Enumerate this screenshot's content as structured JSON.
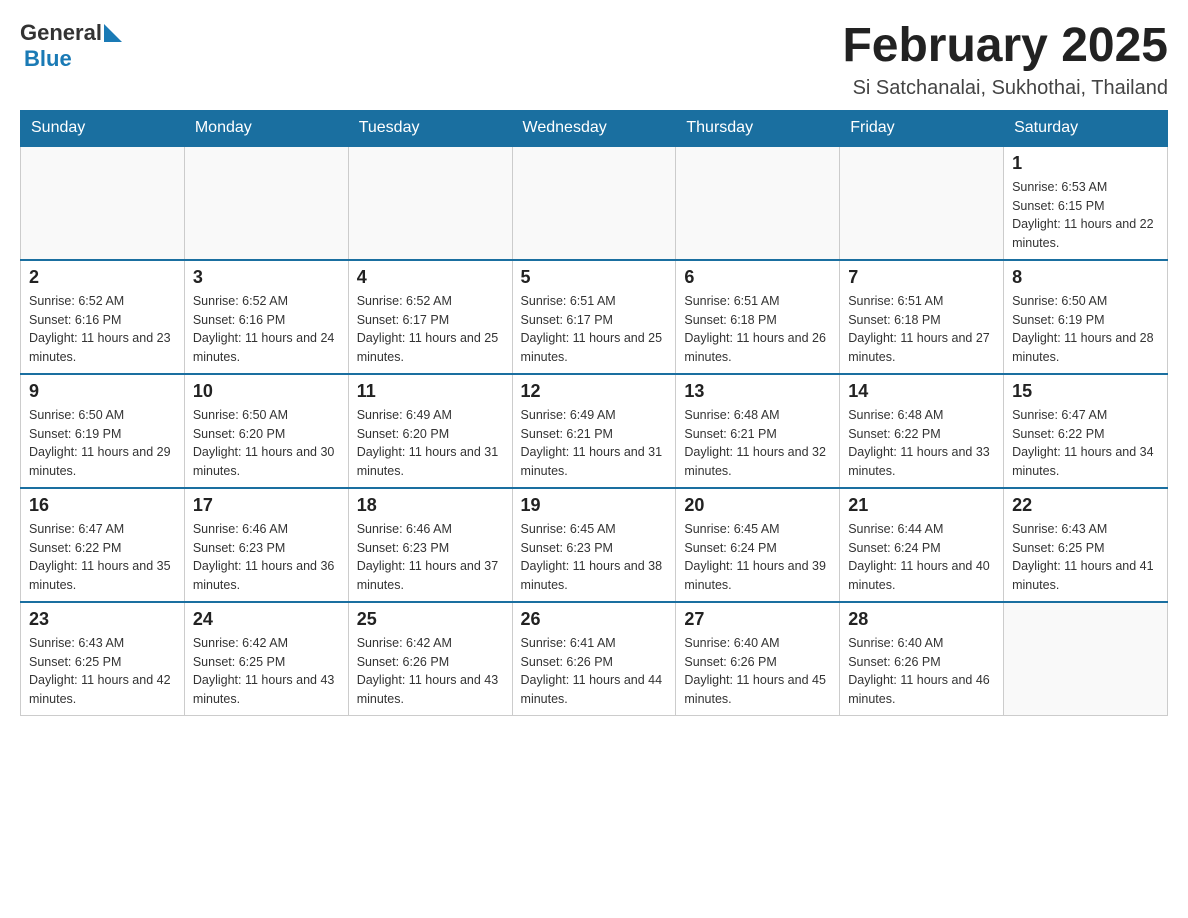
{
  "logo": {
    "general": "General",
    "arrow": "▶",
    "blue": "Blue"
  },
  "title": "February 2025",
  "location": "Si Satchanalai, Sukhothai, Thailand",
  "days_of_week": [
    "Sunday",
    "Monday",
    "Tuesday",
    "Wednesday",
    "Thursday",
    "Friday",
    "Saturday"
  ],
  "weeks": [
    [
      {
        "day": "",
        "info": ""
      },
      {
        "day": "",
        "info": ""
      },
      {
        "day": "",
        "info": ""
      },
      {
        "day": "",
        "info": ""
      },
      {
        "day": "",
        "info": ""
      },
      {
        "day": "",
        "info": ""
      },
      {
        "day": "1",
        "info": "Sunrise: 6:53 AM\nSunset: 6:15 PM\nDaylight: 11 hours and 22 minutes."
      }
    ],
    [
      {
        "day": "2",
        "info": "Sunrise: 6:52 AM\nSunset: 6:16 PM\nDaylight: 11 hours and 23 minutes."
      },
      {
        "day": "3",
        "info": "Sunrise: 6:52 AM\nSunset: 6:16 PM\nDaylight: 11 hours and 24 minutes."
      },
      {
        "day": "4",
        "info": "Sunrise: 6:52 AM\nSunset: 6:17 PM\nDaylight: 11 hours and 25 minutes."
      },
      {
        "day": "5",
        "info": "Sunrise: 6:51 AM\nSunset: 6:17 PM\nDaylight: 11 hours and 25 minutes."
      },
      {
        "day": "6",
        "info": "Sunrise: 6:51 AM\nSunset: 6:18 PM\nDaylight: 11 hours and 26 minutes."
      },
      {
        "day": "7",
        "info": "Sunrise: 6:51 AM\nSunset: 6:18 PM\nDaylight: 11 hours and 27 minutes."
      },
      {
        "day": "8",
        "info": "Sunrise: 6:50 AM\nSunset: 6:19 PM\nDaylight: 11 hours and 28 minutes."
      }
    ],
    [
      {
        "day": "9",
        "info": "Sunrise: 6:50 AM\nSunset: 6:19 PM\nDaylight: 11 hours and 29 minutes."
      },
      {
        "day": "10",
        "info": "Sunrise: 6:50 AM\nSunset: 6:20 PM\nDaylight: 11 hours and 30 minutes."
      },
      {
        "day": "11",
        "info": "Sunrise: 6:49 AM\nSunset: 6:20 PM\nDaylight: 11 hours and 31 minutes."
      },
      {
        "day": "12",
        "info": "Sunrise: 6:49 AM\nSunset: 6:21 PM\nDaylight: 11 hours and 31 minutes."
      },
      {
        "day": "13",
        "info": "Sunrise: 6:48 AM\nSunset: 6:21 PM\nDaylight: 11 hours and 32 minutes."
      },
      {
        "day": "14",
        "info": "Sunrise: 6:48 AM\nSunset: 6:22 PM\nDaylight: 11 hours and 33 minutes."
      },
      {
        "day": "15",
        "info": "Sunrise: 6:47 AM\nSunset: 6:22 PM\nDaylight: 11 hours and 34 minutes."
      }
    ],
    [
      {
        "day": "16",
        "info": "Sunrise: 6:47 AM\nSunset: 6:22 PM\nDaylight: 11 hours and 35 minutes."
      },
      {
        "day": "17",
        "info": "Sunrise: 6:46 AM\nSunset: 6:23 PM\nDaylight: 11 hours and 36 minutes."
      },
      {
        "day": "18",
        "info": "Sunrise: 6:46 AM\nSunset: 6:23 PM\nDaylight: 11 hours and 37 minutes."
      },
      {
        "day": "19",
        "info": "Sunrise: 6:45 AM\nSunset: 6:23 PM\nDaylight: 11 hours and 38 minutes."
      },
      {
        "day": "20",
        "info": "Sunrise: 6:45 AM\nSunset: 6:24 PM\nDaylight: 11 hours and 39 minutes."
      },
      {
        "day": "21",
        "info": "Sunrise: 6:44 AM\nSunset: 6:24 PM\nDaylight: 11 hours and 40 minutes."
      },
      {
        "day": "22",
        "info": "Sunrise: 6:43 AM\nSunset: 6:25 PM\nDaylight: 11 hours and 41 minutes."
      }
    ],
    [
      {
        "day": "23",
        "info": "Sunrise: 6:43 AM\nSunset: 6:25 PM\nDaylight: 11 hours and 42 minutes."
      },
      {
        "day": "24",
        "info": "Sunrise: 6:42 AM\nSunset: 6:25 PM\nDaylight: 11 hours and 43 minutes."
      },
      {
        "day": "25",
        "info": "Sunrise: 6:42 AM\nSunset: 6:26 PM\nDaylight: 11 hours and 43 minutes."
      },
      {
        "day": "26",
        "info": "Sunrise: 6:41 AM\nSunset: 6:26 PM\nDaylight: 11 hours and 44 minutes."
      },
      {
        "day": "27",
        "info": "Sunrise: 6:40 AM\nSunset: 6:26 PM\nDaylight: 11 hours and 45 minutes."
      },
      {
        "day": "28",
        "info": "Sunrise: 6:40 AM\nSunset: 6:26 PM\nDaylight: 11 hours and 46 minutes."
      },
      {
        "day": "",
        "info": ""
      }
    ]
  ]
}
